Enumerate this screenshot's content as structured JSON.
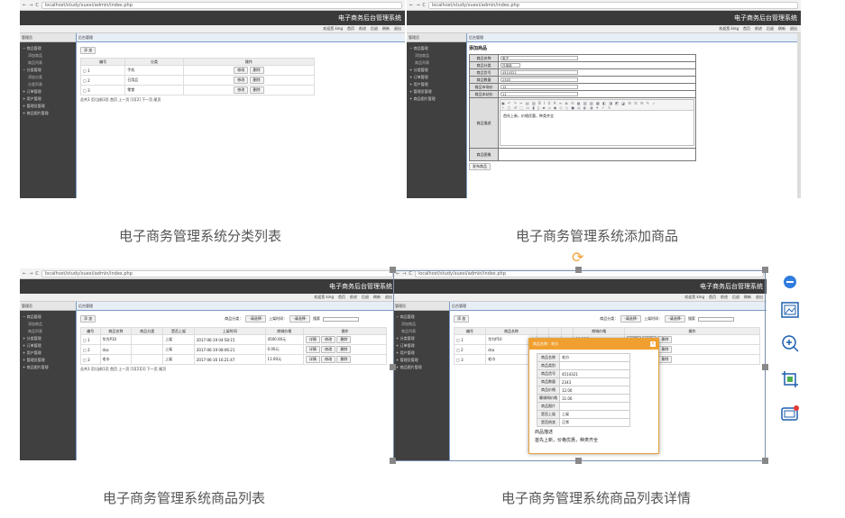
{
  "browser": {
    "url_list": "localhost/study/xuexi/admin/index.php",
    "url_add": "localhost/study/xuexi/admin/index.php"
  },
  "app": {
    "title": "电子商务后台管理系统",
    "top_links": [
      "欢迎您 king",
      "首页",
      "前进",
      "后退",
      "刷新",
      "退出"
    ],
    "side_head": "管理员",
    "breadcrumb": "后台管理",
    "menu": [
      {
        "label": "商品管理",
        "sub": [
          "添加商品",
          "商品列表"
        ]
      },
      {
        "label": "分类管理",
        "sub": [
          "添加分类",
          "分类列表"
        ]
      },
      {
        "label": "订单管理",
        "sub": []
      },
      {
        "label": "用户管理",
        "sub": []
      },
      {
        "label": "管理员管理",
        "sub": []
      },
      {
        "label": "商品图片管理",
        "sub": []
      }
    ],
    "menu_collapsed": [
      "商品管理",
      "分类管理",
      "订单管理",
      "用户管理",
      "管理员管理",
      "商品图片管理"
    ]
  },
  "category_list": {
    "add_label": "添 加",
    "columns": [
      "编号",
      "分类",
      "操作"
    ],
    "rows": [
      {
        "id": "1",
        "name": "手机"
      },
      {
        "id": "2",
        "name": "日用品"
      },
      {
        "id": "3",
        "name": "零食"
      }
    ],
    "edit_label": "修改",
    "delete_label": "删除",
    "pager": "总共3 页/当前3页 首页 上一页 [1][2] 下一页 尾页"
  },
  "add_product": {
    "title": "添加商品",
    "fields": [
      {
        "label": "商品名称",
        "value": "电子"
      },
      {
        "label": "商品分类",
        "value": "日用品"
      },
      {
        "label": "商品货号",
        "value": "4514321"
      },
      {
        "label": "商品数量",
        "value": "2343"
      },
      {
        "label": "商品市场价",
        "value": "12"
      },
      {
        "label": "商品本站价",
        "value": "11"
      }
    ],
    "desc_label": "商品描述",
    "desc_value": "首先上新，价格优惠，种类齐全",
    "image_label": "商品图像",
    "submit_label": "发布商品"
  },
  "product_list": {
    "add_label": "添 加",
    "filter_category": "商品分类：",
    "filter_select": "-请选择-",
    "filter_date": "上架时间：",
    "filter_date_select": "-请选择-",
    "search_label": "搜索",
    "columns": [
      "编号",
      "商品名称",
      "商品分类",
      "是否上架",
      "上架时间",
      "商城价格",
      "操作"
    ],
    "rows": [
      {
        "id": "1",
        "name": "华为P10",
        "cat": "",
        "on": "上架",
        "time": "2017-06-19 04:58:15",
        "price": "4500.00元"
      },
      {
        "id": "2",
        "name": "dsa",
        "cat": "",
        "on": "上架",
        "time": "2017-06-19 08:06:21",
        "price": "0.00元"
      },
      {
        "id": "3",
        "name": "毛巾",
        "cat": "",
        "on": "上架",
        "time": "2017-06-16 16:21:47",
        "price": "11.00元"
      }
    ],
    "detail_label": "详情",
    "edit_label": "修改",
    "delete_label": "删除",
    "pager": "总共3 页/当前1页 首页 上一页 [1][2][3] 下一页 尾页"
  },
  "product_detail": {
    "modal_title": "商品名称：毛巾",
    "rows": [
      {
        "label": "商品名称",
        "value": "毛巾"
      },
      {
        "label": "商品类别",
        "value": ""
      },
      {
        "label": "商品货号",
        "value": "4514321"
      },
      {
        "label": "商品数量",
        "value": "2343"
      },
      {
        "label": "商品价格",
        "value": "12.00"
      },
      {
        "label": "幕课网价格",
        "value": "11.00"
      },
      {
        "label": "商品图片",
        "value": ""
      },
      {
        "label": "是否上架",
        "value": "上架"
      },
      {
        "label": "是否热卖",
        "value": "正常"
      }
    ],
    "desc_title": "商品描述",
    "desc_value": "首先上新，价格优惠，种类齐全",
    "list_rows": [
      {
        "id": "1",
        "name": "华为P10",
        "price": "00.00元"
      },
      {
        "id": "2",
        "name": "dsa",
        "price": "00元"
      },
      {
        "id": "3",
        "name": "毛巾",
        "price": "00元"
      }
    ],
    "col_price": "商城价格"
  },
  "captions": [
    "电子商务管理系统分类列表",
    "电子商务管理系统添加商品",
    "电子商务管理系统商品列表",
    "电子商务管理系统商品列表详情"
  ],
  "tool_icons": [
    "minus-circle-icon",
    "image-icon",
    "zoom-in-icon",
    "crop-icon",
    "screen-record-icon"
  ],
  "accent_color": "#3a3a3a"
}
